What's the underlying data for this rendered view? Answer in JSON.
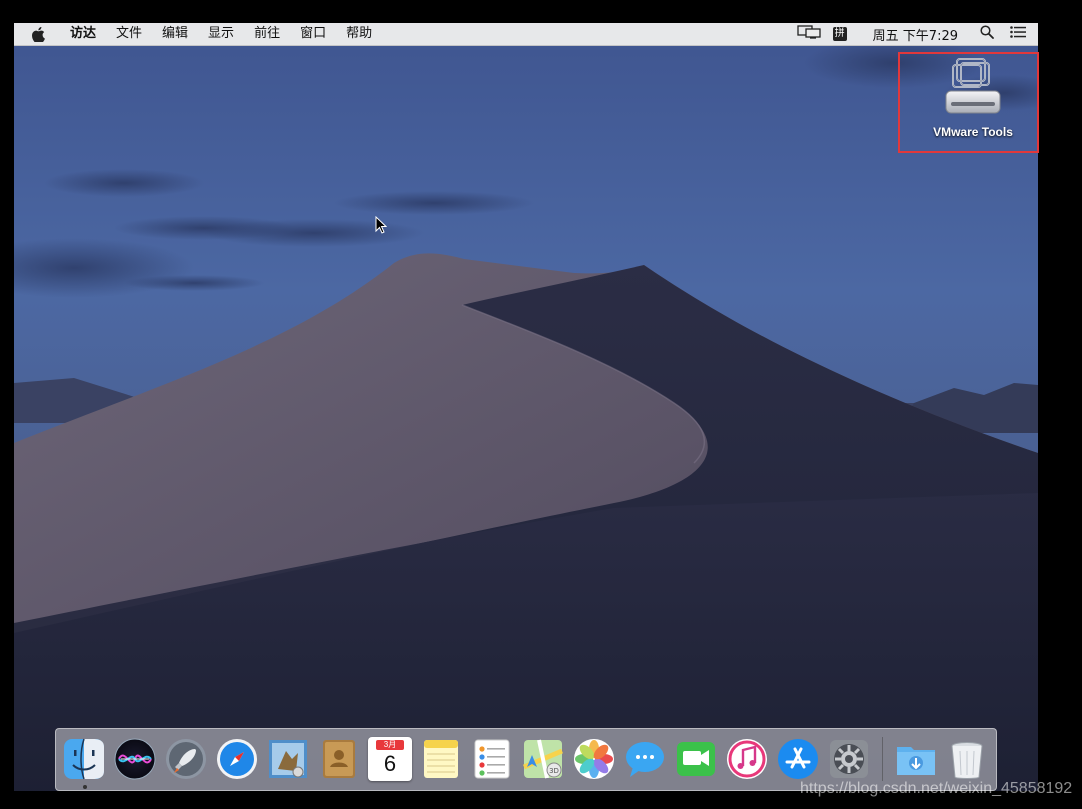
{
  "menubar": {
    "apple_icon": "apple-logo-icon",
    "items": [
      {
        "label": "访达",
        "bold": true
      },
      {
        "label": "文件"
      },
      {
        "label": "编辑"
      },
      {
        "label": "显示"
      },
      {
        "label": "前往"
      },
      {
        "label": "窗口"
      },
      {
        "label": "帮助"
      }
    ],
    "status": {
      "display_icon": "display-mirroring-icon",
      "input_method": "拼",
      "clock": "周五 下午7:29",
      "search_icon": "spotlight-search-icon",
      "notification_icon": "notification-center-icon"
    }
  },
  "desktop": {
    "items": [
      {
        "label": "VMware Tools",
        "icon": "vmware-tools-disk-icon",
        "highlighted": true,
        "highlight_color": "#e2383b"
      }
    ]
  },
  "dock": {
    "apps": [
      {
        "name": "Finder",
        "icon": "finder-icon",
        "running": true
      },
      {
        "name": "Siri",
        "icon": "siri-icon"
      },
      {
        "name": "Launchpad",
        "icon": "launchpad-icon"
      },
      {
        "name": "Safari",
        "icon": "safari-icon"
      },
      {
        "name": "Mail",
        "icon": "mail-icon"
      },
      {
        "name": "Contacts",
        "icon": "contacts-icon"
      },
      {
        "name": "Calendar",
        "icon": "calendar-icon",
        "month": "3月",
        "day": "6"
      },
      {
        "name": "Notes",
        "icon": "notes-icon"
      },
      {
        "name": "Reminders",
        "icon": "reminders-icon"
      },
      {
        "name": "Maps",
        "icon": "maps-icon"
      },
      {
        "name": "Photos",
        "icon": "photos-icon"
      },
      {
        "name": "Messages",
        "icon": "messages-icon"
      },
      {
        "name": "FaceTime",
        "icon": "facetime-icon"
      },
      {
        "name": "iTunes",
        "icon": "itunes-icon"
      },
      {
        "name": "App Store",
        "icon": "app-store-icon"
      },
      {
        "name": "System Preferences",
        "icon": "system-preferences-icon"
      }
    ],
    "others": [
      {
        "name": "Downloads",
        "icon": "downloads-folder-icon"
      },
      {
        "name": "Trash",
        "icon": "trash-icon"
      }
    ]
  },
  "watermark": "https://blog.csdn.net/weixin_45858192"
}
